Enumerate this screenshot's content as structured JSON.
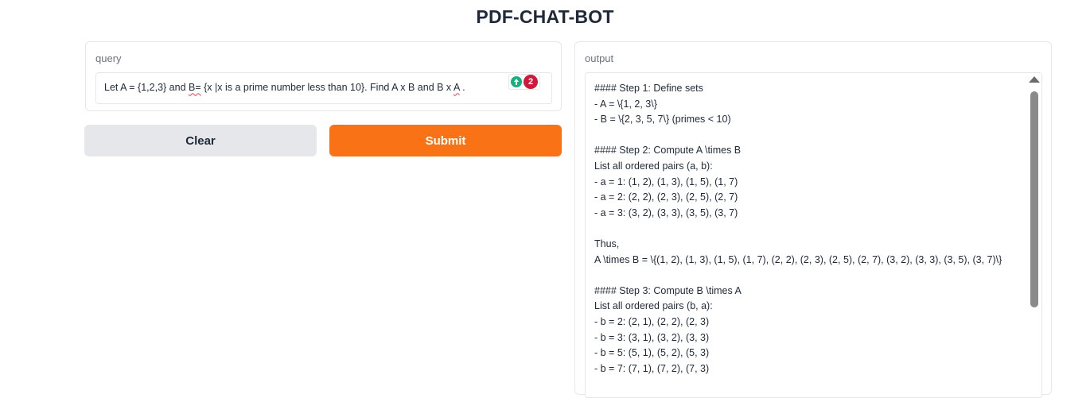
{
  "app": {
    "title": "PDF-CHAT-BOT"
  },
  "query": {
    "label": "query",
    "value_parts": [
      "Let A = {1,2,3} and ",
      "B=",
      " {x |x  is a prime number less than 10}. Find A x B  and B x ",
      "A",
      " ."
    ],
    "extension_count": "2"
  },
  "buttons": {
    "clear_label": "Clear",
    "submit_label": "Submit"
  },
  "output": {
    "label": "output",
    "lines": [
      "#### Step 1: Define sets",
      "- A = \\{1, 2, 3\\}",
      "- B = \\{2, 3, 5, 7\\} (primes < 10)",
      "",
      "#### Step 2: Compute A \\times B",
      "List all ordered pairs (a, b):",
      "- a = 1: (1, 2), (1, 3), (1, 5), (1, 7)",
      "- a = 2: (2, 2), (2, 3), (2, 5), (2, 7)",
      "- a = 3: (3, 2), (3, 3), (3, 5), (3, 7)",
      "",
      "Thus,",
      "A \\times B = \\{(1, 2), (1, 3), (1, 5), (1, 7), (2, 2), (2, 3), (2, 5), (2, 7), (3, 2), (3, 3), (3, 5), (3, 7)\\}",
      "",
      "#### Step 3: Compute B \\times A",
      "List all ordered pairs (b, a):",
      "- b = 2: (2, 1), (2, 2), (2, 3)",
      "- b = 3: (3, 1), (3, 2), (3, 3)",
      "- b = 5: (5, 1), (5, 2), (5, 3)",
      "- b = 7: (7, 1), (7, 2), (7, 3)",
      ""
    ]
  },
  "colors": {
    "submit_bg": "#f97316",
    "clear_bg": "#e5e7eb",
    "badge_red": "#d0183c",
    "badge_green": "#15b07e"
  }
}
